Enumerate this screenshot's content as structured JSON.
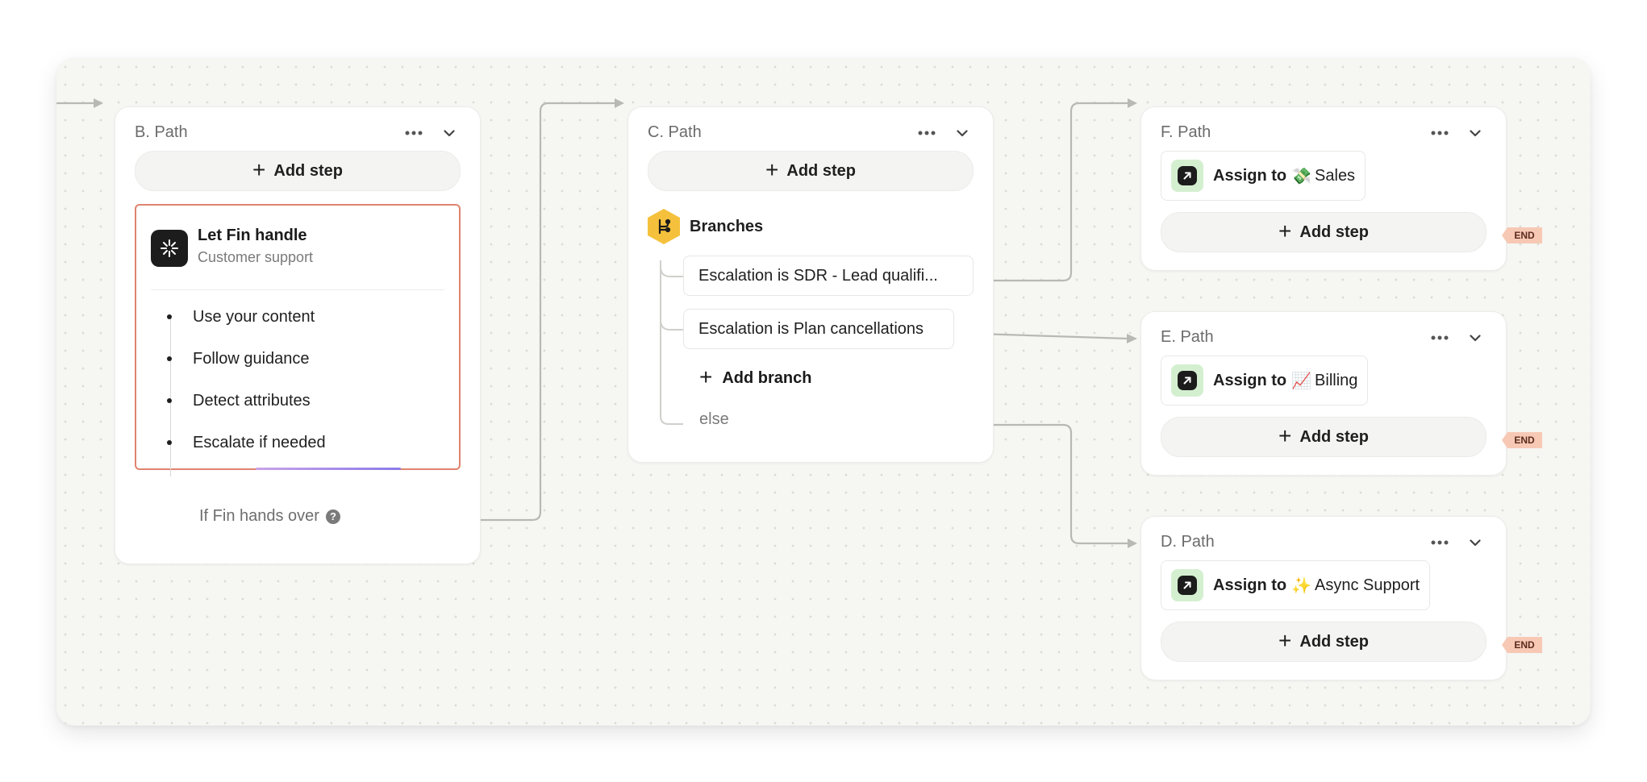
{
  "paths": {
    "b": {
      "title": "B. Path",
      "add_step": "Add step",
      "fin": {
        "title": "Let Fin handle",
        "subtitle": "Customer support",
        "items": [
          "Use your content",
          "Follow guidance",
          "Detect attributes",
          "Escalate if needed"
        ]
      },
      "handover": "If Fin hands over",
      "help_glyph": "?"
    },
    "c": {
      "title": "C. Path",
      "add_step": "Add step",
      "branches_label": "Branches",
      "branches": [
        "Escalation is SDR - Lead qualifi...",
        "Escalation is Plan cancellations"
      ],
      "add_branch": "Add branch",
      "else_label": "else"
    },
    "f": {
      "title": "F. Path",
      "assign_prefix": "Assign to",
      "assign_emoji": "💸",
      "assign_target": "Sales",
      "add_step": "Add step"
    },
    "e": {
      "title": "E. Path",
      "assign_prefix": "Assign to",
      "assign_emoji": "📈",
      "assign_target": "Billing",
      "add_step": "Add step"
    },
    "d": {
      "title": "D. Path",
      "assign_prefix": "Assign to",
      "assign_emoji": "✨",
      "assign_target": "Async Support",
      "add_step": "Add step"
    }
  },
  "end_label": "END",
  "icons": {
    "menu": "more-horizontal-icon",
    "collapse": "chevron-down-icon",
    "fin": "fin-logo-icon",
    "branches": "branch-icon",
    "assign": "assign-arrow-icon",
    "plus": "plus-icon"
  },
  "colors": {
    "fin_border": "#e0836f",
    "branch_hex": "#f5c13c",
    "assign_tile": "#d4efd0",
    "end_tag": "#f7c9b4"
  }
}
